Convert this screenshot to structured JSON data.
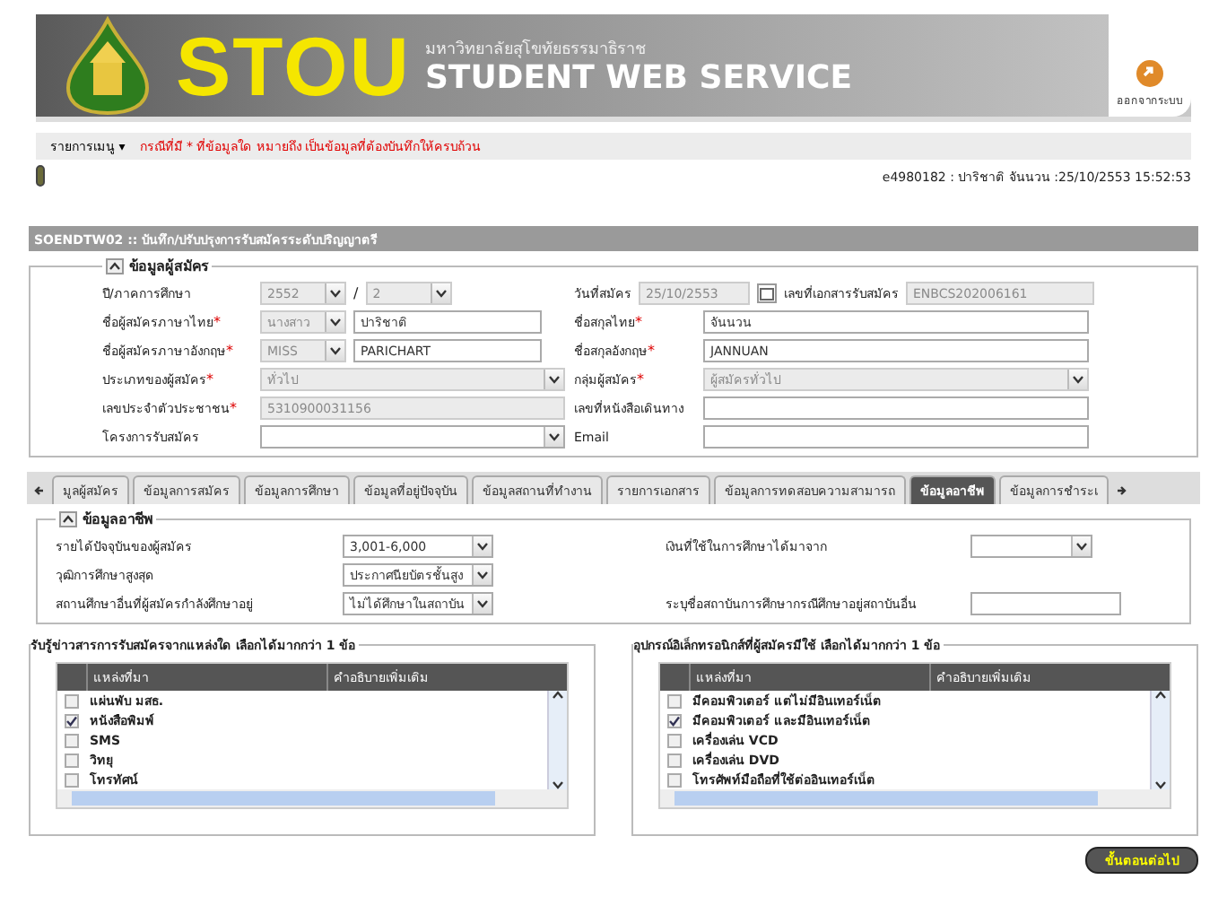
{
  "header": {
    "logo_text": "STOU",
    "university": "มหาวิทยาลัยสุโขทัยธรรมาธิราช",
    "service": "STUDENT WEB SERVICE",
    "logout": "ออกจากระบบ"
  },
  "menu_bar": {
    "menu": "รายการเมนู",
    "caret": "▾",
    "notice": "กรณีที่มี * ที่ข้อมูลใด หมายถึง เป็นข้อมูลที่ต้องบันทึกให้ครบถ้วน"
  },
  "user_info": "e4980182 : ปาริชาติ จันนวน :25/10/2553 15:52:53",
  "page_title": "SOENDTW02 :: บันทึก/ปรับปรุงการรับสมัครระดับปริญญาตรี",
  "applicant_section": {
    "title": "ข้อมูลผู้สมัคร",
    "expanded": true,
    "rows": [
      {
        "left": {
          "label": "ปี/ภาคการศึกษา",
          "controls": [
            {
              "kind": "select",
              "value": "2552",
              "disabled": true
            },
            {
              "kind": "separator",
              "text": "/"
            },
            {
              "kind": "select",
              "value": "2",
              "disabled": true
            }
          ]
        },
        "right": [
          {
            "label": "วันที่สมัคร",
            "controls": [
              {
                "kind": "date",
                "value": "25/10/2553",
                "disabled": true
              }
            ]
          },
          {
            "label": "เลขที่เอกสารรับสมัคร",
            "controls": [
              {
                "kind": "text",
                "value": "ENBCS202006161",
                "disabled": true
              }
            ]
          }
        ]
      },
      {
        "left": {
          "label": "ชื่อผู้สมัครภาษาไทย",
          "marker": "*",
          "controls": [
            {
              "kind": "select",
              "value": "นางสาว",
              "disabled": true
            },
            {
              "kind": "text",
              "value": "ปาริชาติ",
              "disabled": false
            }
          ]
        },
        "right": [
          {
            "label": "ชื่อสกุลไทย",
            "marker": "*",
            "controls": [
              {
                "kind": "text",
                "value": "จันนวน",
                "disabled": false
              }
            ]
          }
        ]
      },
      {
        "left": {
          "label": "ชื่อผู้สมัครภาษาอังกฤษ",
          "marker": "*",
          "controls": [
            {
              "kind": "select",
              "value": "MISS",
              "disabled": true
            },
            {
              "kind": "text",
              "value": "PARICHART",
              "disabled": false
            }
          ]
        },
        "right": [
          {
            "label": "ชื่อสกุลอังกฤษ",
            "marker": "*",
            "controls": [
              {
                "kind": "text",
                "value": "JANNUAN",
                "disabled": false
              }
            ]
          }
        ]
      },
      {
        "left": {
          "label": "ประเภทของผู้สมัคร",
          "marker": "*",
          "controls": [
            {
              "kind": "select",
              "value": "ทั่วไป",
              "disabled": true
            }
          ]
        },
        "right": [
          {
            "label": "กลุ่มผู้สมัคร",
            "marker": "*",
            "controls": [
              {
                "kind": "select",
                "value": "ผู้สมัครทั่วไป",
                "disabled": true
              }
            ]
          }
        ]
      },
      {
        "left": {
          "label": "เลขประจำตัวประชาชน",
          "marker": "*",
          "controls": [
            {
              "kind": "text",
              "value": "5310900031156",
              "disabled": true
            }
          ]
        },
        "right": [
          {
            "label": "เลขที่หนังสือเดินทาง",
            "controls": [
              {
                "kind": "text"
              }
            ]
          }
        ]
      },
      {
        "left": {
          "label": "โครงการรับสมัคร",
          "controls": [
            {
              "kind": "select"
            }
          ]
        },
        "right": [
          {
            "label": "Email",
            "controls": [
              {
                "kind": "text"
              }
            ]
          }
        ]
      }
    ]
  },
  "tabs": [
    {
      "label": "มูลผู้สมัคร",
      "selected": false
    },
    {
      "label": "ข้อมูลการสมัคร",
      "selected": false
    },
    {
      "label": "ข้อมูลการศึกษา",
      "selected": false
    },
    {
      "label": "ข้อมูลที่อยู่ปัจจุบัน",
      "selected": false
    },
    {
      "label": "ข้อมูลสถานที่ทำงาน",
      "selected": false
    },
    {
      "label": "รายการเอกสาร",
      "selected": false
    },
    {
      "label": "ข้อมูลการทดสอบความสามารถ",
      "selected": false
    },
    {
      "label": "ข้อมูลอาชีพ",
      "selected": true
    },
    {
      "label": "ข้อมูลการชำระเ",
      "selected": false
    }
  ],
  "career_section": {
    "title": "ข้อมูลอาชีพ",
    "expanded": true,
    "rows": [
      {
        "left": {
          "label": "รายได้ปัจจุบันของผู้สมัคร",
          "value": "3,001-6,000",
          "kind": "select"
        },
        "right": {
          "label": "เงินที่ใช้ในการศึกษาได้มาจาก",
          "kind": "select"
        }
      },
      {
        "left": {
          "label": "วุฒิการศึกษาสูงสุด",
          "value": "ประกาศนียบัตรชั้นสูง",
          "kind": "select"
        }
      },
      {
        "left": {
          "label": "สถานศึกษาอื่นที่ผู้สมัครกำลังศึกษาอยู่",
          "value": "ไม่ได้ศึกษาในสถาบัน",
          "kind": "select"
        },
        "right": {
          "label": "ระบุชื่อสถาบันการศึกษากรณีศึกษาอยู่สถาบันอื่น",
          "kind": "text"
        }
      }
    ]
  },
  "choice_groups": [
    {
      "title": "รับรู้ข่าวสารการรับสมัครจากแหล่งใด เลือกได้มากกว่า 1 ข้อ",
      "columns": [
        "แหล่งที่มา",
        "คำอธิบายเพิ่มเติม"
      ],
      "rows": [
        {
          "label": "แผ่นพับ มสธ.",
          "checked": false
        },
        {
          "label": "หนังสือพิมพ์",
          "checked": true
        },
        {
          "label": "SMS",
          "checked": false
        },
        {
          "label": "วิทยุ",
          "checked": false
        },
        {
          "label": "โทรทัศน์",
          "checked": false
        }
      ]
    },
    {
      "title": "อุปกรณ์อิเล็กทรอนิกส์ที่ผู้สมัครมีใช้ เลือกได้มากกว่า 1 ข้อ",
      "columns": [
        "แหล่งที่มา",
        "คำอธิบายเพิ่มเติม"
      ],
      "rows": [
        {
          "label": "มีคอมพิวเตอร์ แต่ไม่มีอินเทอร์เน็ต",
          "checked": false
        },
        {
          "label": "มีคอมพิวเตอร์ และมีอินเทอร์เน็ต",
          "checked": true
        },
        {
          "label": "เครื่องเล่น VCD",
          "checked": false
        },
        {
          "label": "เครื่องเล่น DVD",
          "checked": false
        },
        {
          "label": "โทรศัพท์มือถือที่ใช้ต่ออินเทอร์เน็ต",
          "checked": false
        }
      ]
    }
  ],
  "next_button": "ขั้นตอนต่อไป"
}
